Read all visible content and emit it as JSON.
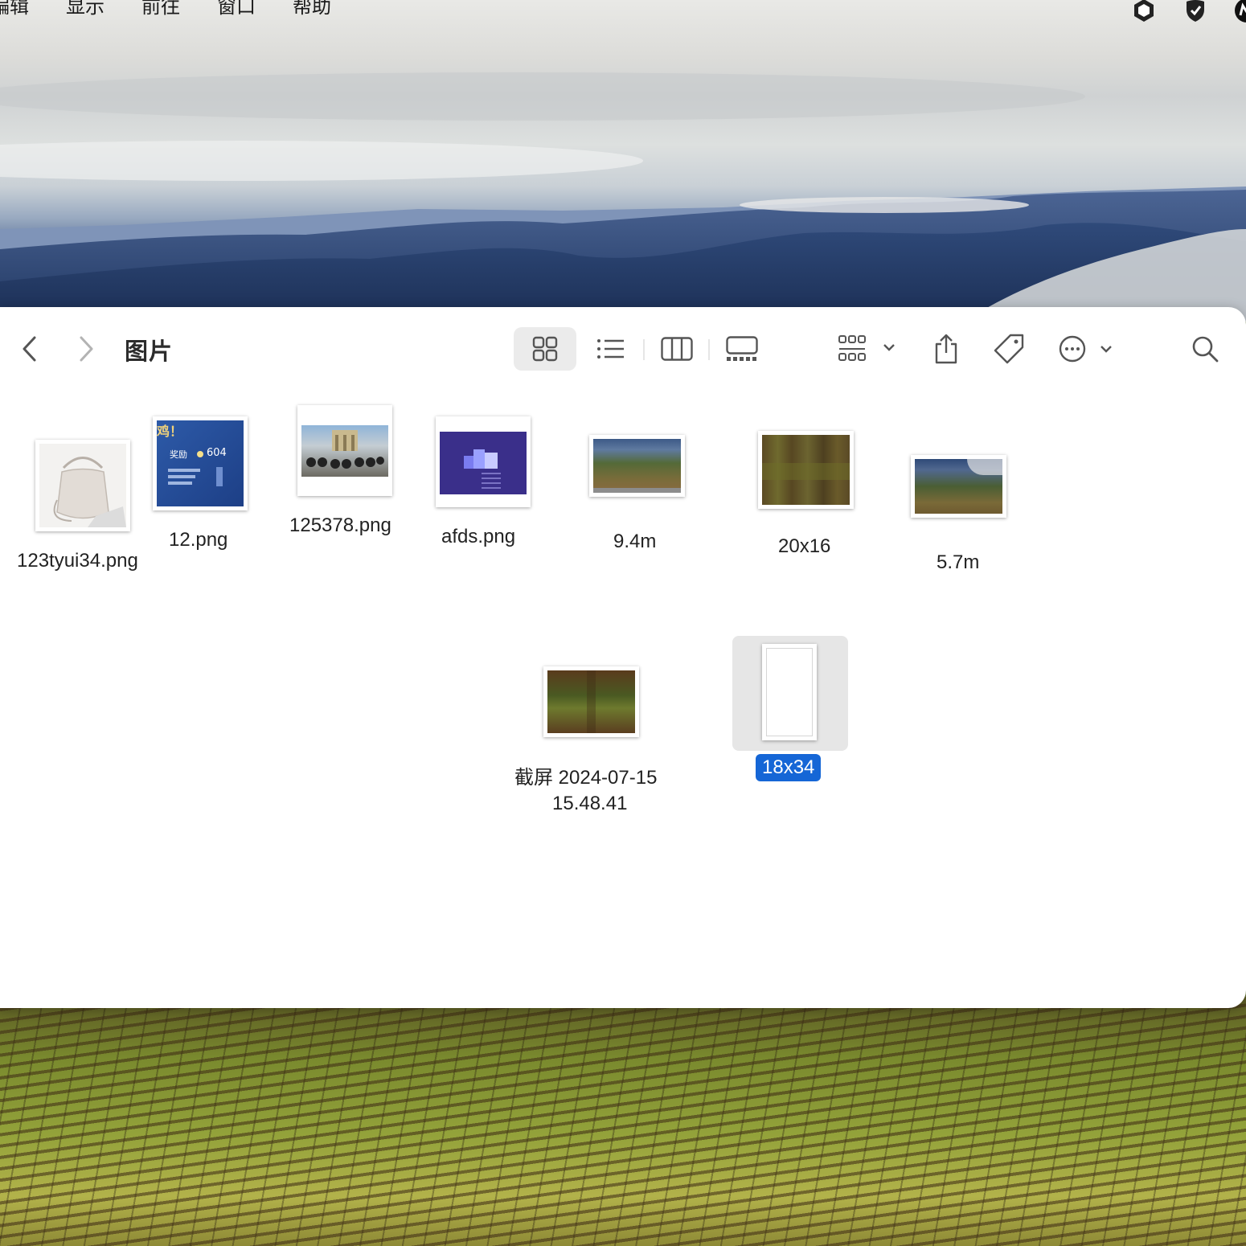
{
  "menubar": {
    "items": [
      "编辑",
      "显示",
      "前往",
      "窗口",
      "帮助"
    ],
    "status_icons": [
      "shield-hex-icon",
      "shield-check-icon",
      "m-app-icon"
    ]
  },
  "window": {
    "title": "图片",
    "toolbar": {
      "back": "chevron-left-icon",
      "forward": "chevron-right-icon",
      "views": [
        "icon-view",
        "list-view",
        "column-view",
        "gallery-view"
      ],
      "selected_view": "icon-view"
    }
  },
  "files": [
    {
      "name": "123tyui34.png",
      "kind": "handbag photo"
    },
    {
      "name": "12.png",
      "kind": "blue screenshot",
      "thumb_text": [
        "鸡！",
        "奖励",
        "604"
      ]
    },
    {
      "name": "125378.png",
      "kind": "cyclists photo"
    },
    {
      "name": "afds.png",
      "kind": "purple slide"
    },
    {
      "name": "9.4m",
      "kind": "landscape"
    },
    {
      "name": "20x16",
      "kind": "pixelated landscape"
    },
    {
      "name": "5.7m",
      "kind": "landscape"
    },
    {
      "name": "截屏 2024-07-15 15.48.41",
      "line1": "截屏 2024-07-15",
      "line2": "15.48.41",
      "kind": "pixelated landscape"
    },
    {
      "name": "18x34",
      "kind": "blank portrait",
      "selected": true
    }
  ],
  "colors": {
    "selection": "#1566d6",
    "selected_tile": "#e6e6e6",
    "window_bg": "#ffffff"
  }
}
